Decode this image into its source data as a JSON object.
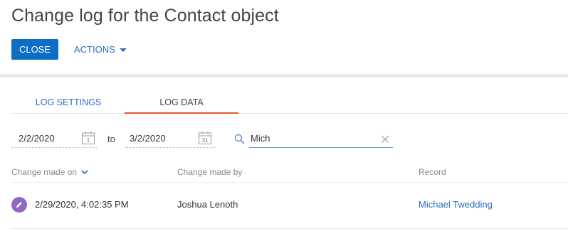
{
  "page": {
    "title": "Change log for the Contact object"
  },
  "toolbar": {
    "close_label": "CLOSE",
    "actions_label": "ACTIONS"
  },
  "tabs": [
    {
      "label": "LOG SETTINGS",
      "active": false
    },
    {
      "label": "LOG DATA",
      "active": true
    }
  ],
  "filters": {
    "date_from": "2/2/2020",
    "date_to": "3/2/2020",
    "to_label": "to",
    "search_value": "Mich",
    "calendar_from_day": "1",
    "calendar_to_day": "31"
  },
  "table": {
    "columns": [
      "Change made on",
      "Change made by",
      "Record"
    ],
    "rows": [
      {
        "changed_on": "2/29/2020, 4:02:35 PM",
        "changed_by": "Joshua Lenoth",
        "record": "Michael Twedding",
        "icon": "pencil-icon"
      }
    ]
  },
  "colors": {
    "accent": "#0d6ec8",
    "link": "#2d6cc0",
    "active_tab": "#e3542a",
    "edit_badge": "#8f68c9"
  }
}
